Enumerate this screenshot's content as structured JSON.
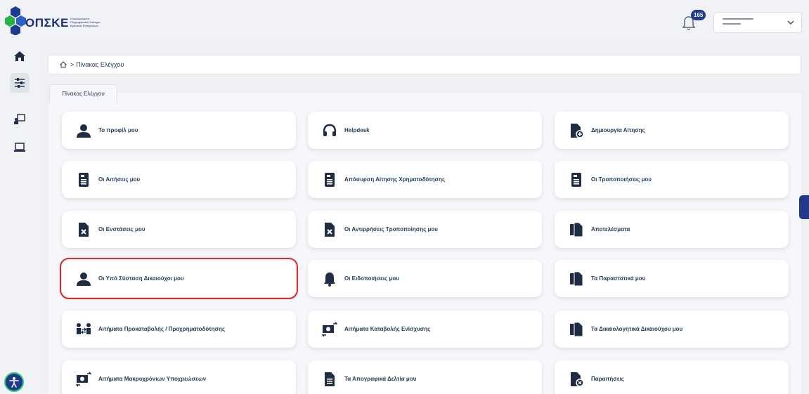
{
  "header": {
    "logo_text": "ΟΠΣΚΕ",
    "logo_subtitle": "Ολοκληρωμένο Πληροφοριακό Σύστημα Κρατικών Ενισχύσεων",
    "notification_count": "165",
    "user_name": "",
    "colors": {
      "brand": "#1c2f7a",
      "badge": "#1f3a8a",
      "highlight": "#e02a2a"
    }
  },
  "sidebar": {
    "items": [
      {
        "icon": "home-icon"
      },
      {
        "icon": "sliders-icon"
      },
      {
        "icon": "presentation-icon"
      },
      {
        "icon": "laptop-icon"
      }
    ]
  },
  "breadcrumb": {
    "current": "Πίνακας Ελέγχου",
    "separator": ">"
  },
  "tab": {
    "label": "Πίνακας Ελέγχου"
  },
  "cards": [
    {
      "label": "Το προφίλ μου",
      "icon": "user-icon"
    },
    {
      "label": "Helpdesk",
      "icon": "headset-icon"
    },
    {
      "label": "Δημιουργία Αίτησης",
      "icon": "file-plus-icon"
    },
    {
      "label": "Οι Αιτήσεις μου",
      "icon": "document-icon"
    },
    {
      "label": "Απόσυρση Αίτησης Χρηματοδότησης",
      "icon": "document-icon"
    },
    {
      "label": "Οι Τροποποιήσεις μου",
      "icon": "document-icon"
    },
    {
      "label": "Οι Ενστάσεις μου",
      "icon": "file-x-icon"
    },
    {
      "label": "Οι Αντιρρήσεις Τροποποίησης μου",
      "icon": "file-x-icon"
    },
    {
      "label": "Αποτελέσματα",
      "icon": "files-icon"
    },
    {
      "label": "Οι Υπό Σύσταση Δικαιούχοι μου",
      "icon": "user-icon"
    },
    {
      "label": "Οι Ειδοποιήσεις μου",
      "icon": "bell-icon"
    },
    {
      "label": "Τα Παραστατικά μου",
      "icon": "files-icon"
    },
    {
      "label": "Αιτήματα Προκαταβολής / Προχρηματοδότησης",
      "icon": "users-exchange-icon"
    },
    {
      "label": "Αιτήματα Καταβολής Ενίσχυσης",
      "icon": "money-exchange-icon"
    },
    {
      "label": "Τα Δικαιολογητικά Δικαιούχου μου",
      "icon": "files-icon"
    },
    {
      "label": "Αιτήματα Μακροχρόνιων Υποχρεώσεων",
      "icon": "money-exchange-icon"
    },
    {
      "label": "Τα Απογραφικά Δελτία μου",
      "icon": "file-lines-icon"
    },
    {
      "label": "Παραιτήσεις",
      "icon": "file-x-circle-icon"
    }
  ]
}
